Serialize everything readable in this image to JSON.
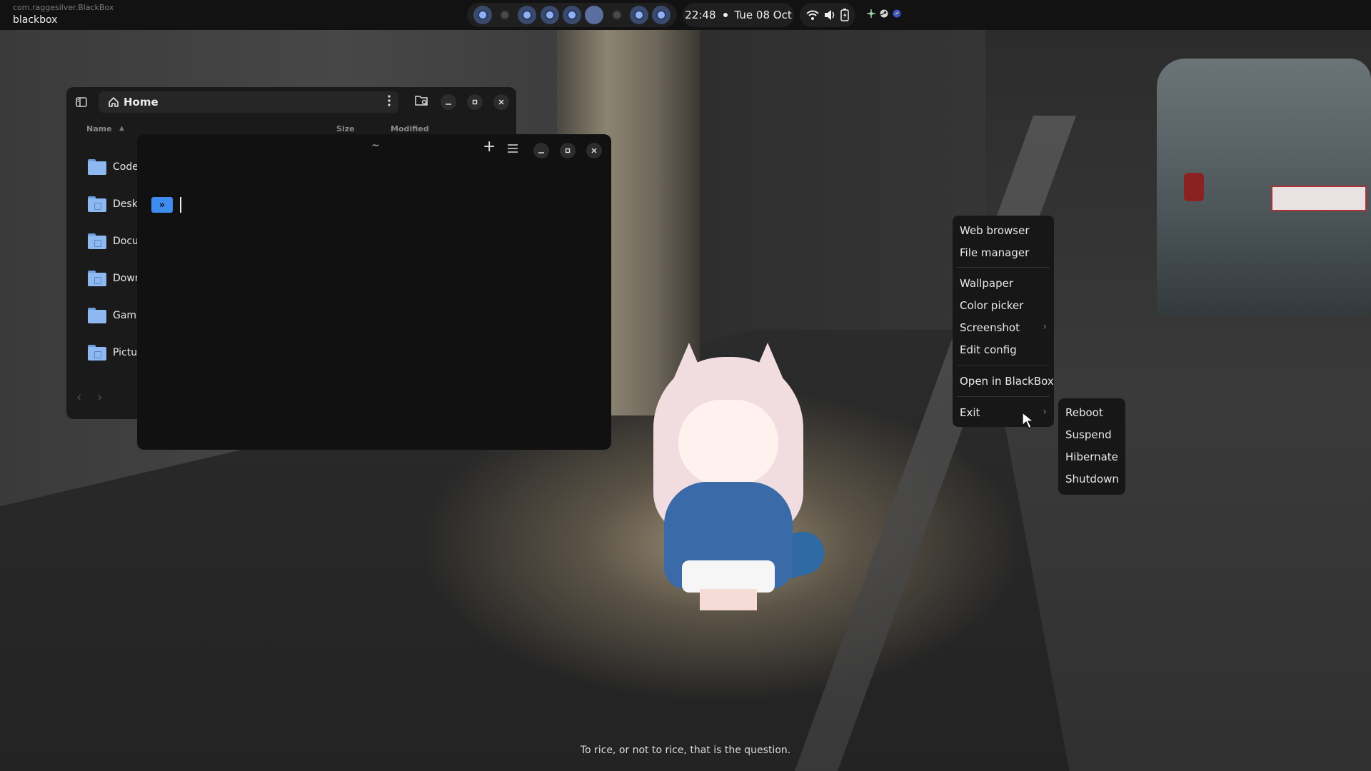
{
  "topbar": {
    "app_id": "com.raggesilver.BlackBox",
    "app_name": "blackbox",
    "workspaces": [
      {
        "state": "occupied"
      },
      {
        "state": "empty"
      },
      {
        "state": "occupied"
      },
      {
        "state": "occupied"
      },
      {
        "state": "occupied"
      },
      {
        "state": "active"
      },
      {
        "state": "empty"
      },
      {
        "state": "occupied"
      },
      {
        "state": "occupied"
      }
    ],
    "time": "22:48",
    "date": "Tue 08 Oct",
    "status_icons": [
      "wifi-icon",
      "volume-icon",
      "battery-charging-icon"
    ],
    "tray_icons": [
      "app-tray-icon",
      "steam-icon",
      "discord-icon"
    ]
  },
  "file_manager": {
    "location": "Home",
    "columns": {
      "name": "Name",
      "size": "Size",
      "modified": "Modified"
    },
    "items": [
      {
        "name": "Code",
        "emblem": ""
      },
      {
        "name": "Deskt",
        "emblem": "desktop"
      },
      {
        "name": "Docu",
        "emblem": "document"
      },
      {
        "name": "Dowr",
        "emblem": "download"
      },
      {
        "name": "Game",
        "emblem": ""
      },
      {
        "name": "Pictu",
        "emblem": "picture"
      }
    ]
  },
  "terminal": {
    "title": "~",
    "prompt_symbol": "»"
  },
  "context_menu": {
    "items": [
      {
        "label": "Web browser"
      },
      {
        "label": "File manager"
      },
      {
        "label": "Wallpaper"
      },
      {
        "label": "Color picker"
      },
      {
        "label": "Screenshot"
      },
      {
        "label": "Edit config"
      },
      {
        "label": "Open in BlackBox"
      },
      {
        "label": "Exit"
      }
    ],
    "exit_submenu": [
      {
        "label": "Reboot"
      },
      {
        "label": "Suspend"
      },
      {
        "label": "Hibernate"
      },
      {
        "label": "Shutdown"
      }
    ]
  },
  "desktop_quote": "To rice, or not to rice, that is the question.",
  "colors": {
    "accent": "#8fb0f8",
    "prompt_badge": "#3f8cf0",
    "folder": "#8db9f0"
  }
}
